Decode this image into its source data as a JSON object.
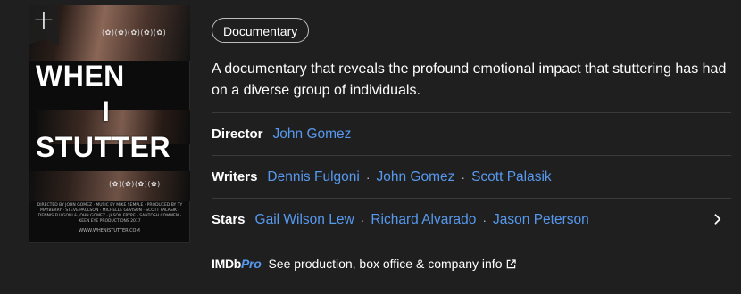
{
  "poster": {
    "add_label": "+",
    "title_lines": [
      "WHEN",
      "I",
      "STUTTER"
    ],
    "laurels_top": "(✿)(✿)(✿)(✿)(✿)",
    "laurels_bottom": "(✿)(✿)(✿)(✿)",
    "credits_text": "DIRECTED BY JOHN GOMEZ · MUSIC BY MIKE SEMPLE · PRODUCED BY TY MAYBERRY · STEVE PAULSON · MICHELLE GEVISON · SCOTT PALASIK · DENNIS FULGONI & JOHN GOMEZ · JASON FRYRE · SANTOSH COMMEN · KEEN EYE PRODUCTIONS 2017",
    "website": "WWW.WHENISTUTTER.COM"
  },
  "genre_chip": "Documentary",
  "plot": "A documentary that reveals the profound emotional impact that stuttering has had on a diverse group of individuals.",
  "director": {
    "label": "Director",
    "names": [
      "John Gomez"
    ]
  },
  "writers": {
    "label": "Writers",
    "names": [
      "Dennis Fulgoni",
      "John Gomez",
      "Scott Palasik"
    ]
  },
  "stars": {
    "label": "Stars",
    "names": [
      "Gail Wilson Lew",
      "Richard Alvarado",
      "Jason Peterson"
    ]
  },
  "separator": "·",
  "imdbpro": {
    "logo_imdb": "IMDb",
    "logo_pro": "Pro",
    "link_text": "See production, box office & company info"
  },
  "colors": {
    "background": "#1f1f1f",
    "link": "#5799ef",
    "divider": "#3a3a3a"
  }
}
